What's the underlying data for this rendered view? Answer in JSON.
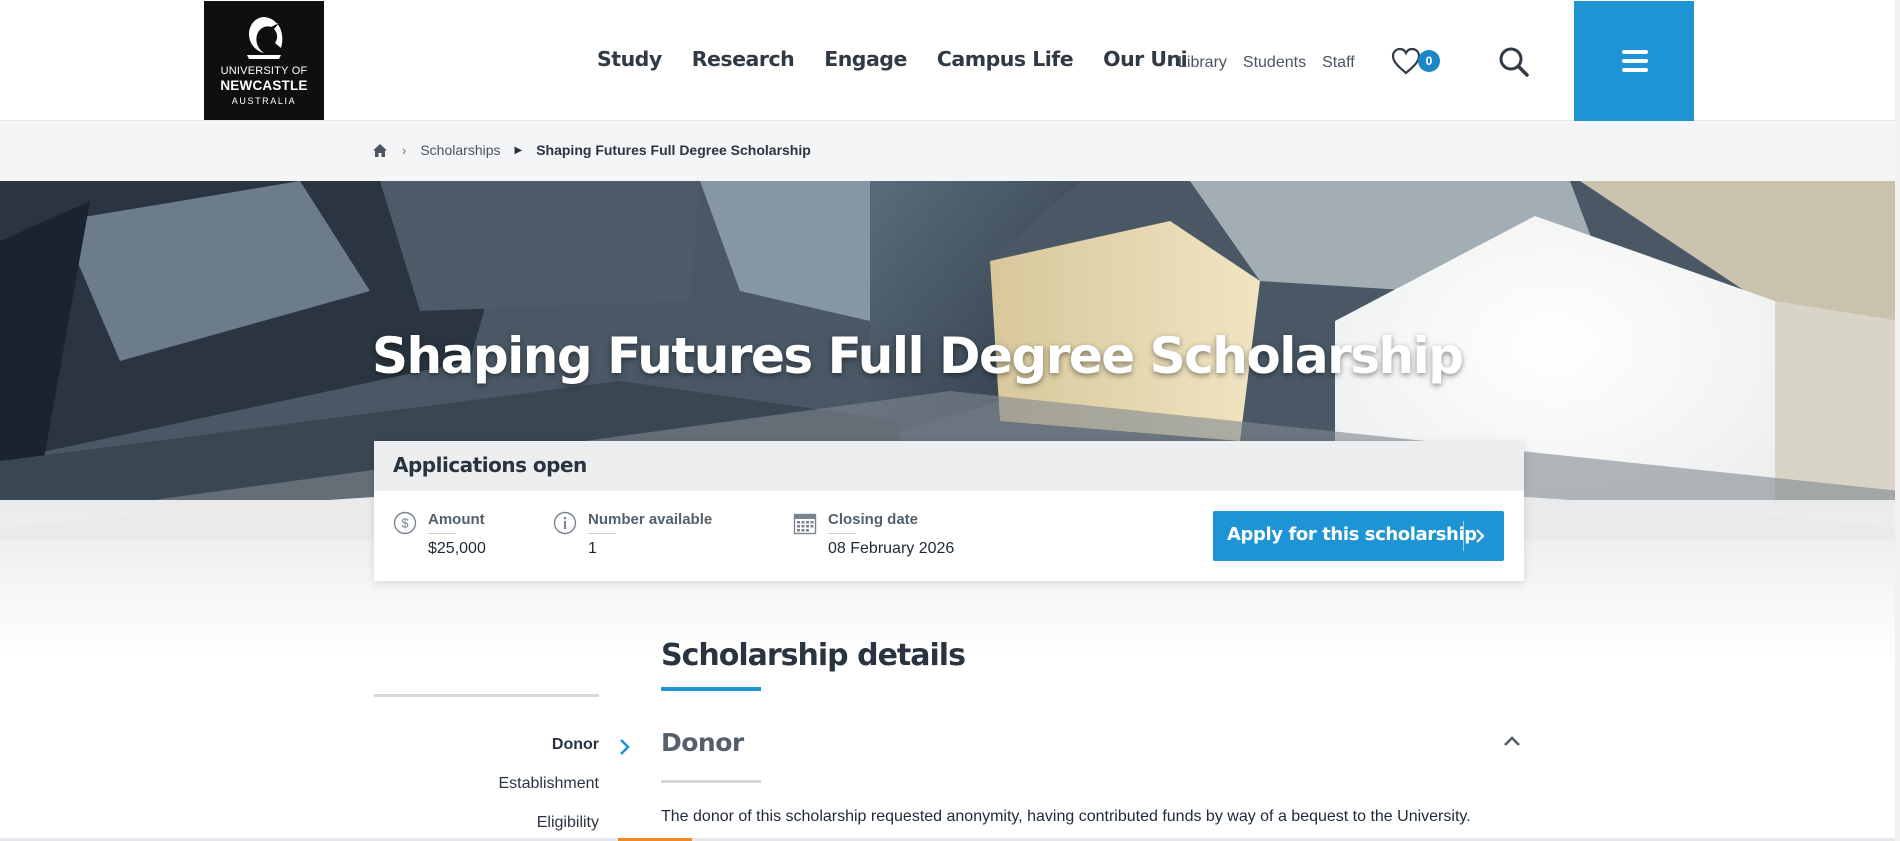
{
  "header": {
    "logo": {
      "line1": "UNIVERSITY OF",
      "line2": "NEWCASTLE",
      "line3": "AUSTRALIA"
    },
    "main_nav": [
      "Study",
      "Research",
      "Engage",
      "Campus Life",
      "Our Uni"
    ],
    "sub_nav": [
      "Library",
      "Students",
      "Staff"
    ],
    "favourites_count": "0",
    "icons": {
      "favourites": "heart-icon",
      "search": "search-icon",
      "menu": "hamburger-menu-icon"
    },
    "accent_color": "#1e94d5"
  },
  "breadcrumb": {
    "home_icon": "home-icon",
    "items": [
      "Scholarships",
      "Shaping Futures Full Degree Scholarship"
    ]
  },
  "hero": {
    "title": "Shaping Futures Full Degree Scholarship"
  },
  "application_card": {
    "status": "Applications open",
    "amount_label": "Amount",
    "amount_value": "$25,000",
    "number_label": "Number available",
    "number_value": "1",
    "closing_label": "Closing date",
    "closing_value": "08 February 2026",
    "apply_label": "Apply for this scholarship",
    "icons": {
      "amount": "dollar-circle-icon",
      "number": "info-circle-icon",
      "closing": "calendar-icon",
      "apply": "chevron-right-icon"
    }
  },
  "details": {
    "title": "Scholarship details",
    "side_nav": [
      "Donor",
      "Establishment",
      "Eligibility"
    ],
    "active_section": "Donor",
    "donor_heading": "Donor",
    "donor_text": "The donor of this scholarship requested anonymity, having contributed funds by way of a bequest to the University."
  }
}
